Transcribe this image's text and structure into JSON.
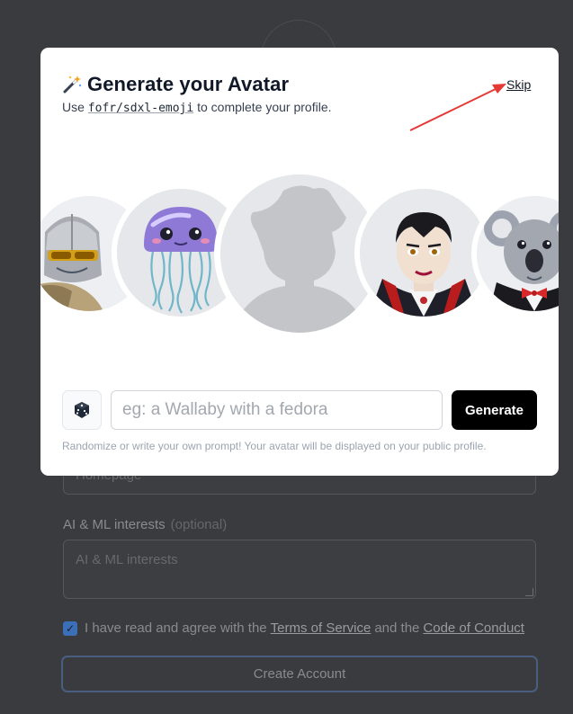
{
  "background": {
    "homepage_placeholder": "Homepage",
    "interests_label": "AI & ML interests",
    "interests_optional": "(optional)",
    "interests_placeholder": "AI & ML interests",
    "agree_prefix": "I have read and agree with the",
    "terms_link": "Terms of Service",
    "agree_and": "and the",
    "conduct_link": "Code of Conduct",
    "create_button": "Create Account",
    "checkbox_checked": true
  },
  "modal": {
    "title": "Generate your Avatar",
    "subtitle_prefix": "Use",
    "model_link": "fofr/sdxl-emoji",
    "subtitle_suffix": "to complete your profile.",
    "skip_label": "Skip",
    "avatars": [
      "knight-avatar",
      "jellyfish-avatar",
      "placeholder-silhouette-avatar",
      "vampire-avatar",
      "koala-avatar"
    ],
    "prompt_placeholder": "eg: a Wallaby with a fedora",
    "prompt_value": "",
    "generate_label": "Generate",
    "helper_text": "Randomize or write your own prompt! Your avatar will be displayed on your public profile."
  },
  "colors": {
    "overlay": "#3a3b3e",
    "modal_bg": "#ffffff",
    "generate_bg": "#000000",
    "annotation_arrow": "#e53935",
    "checkbox": "#3b6fb8"
  }
}
